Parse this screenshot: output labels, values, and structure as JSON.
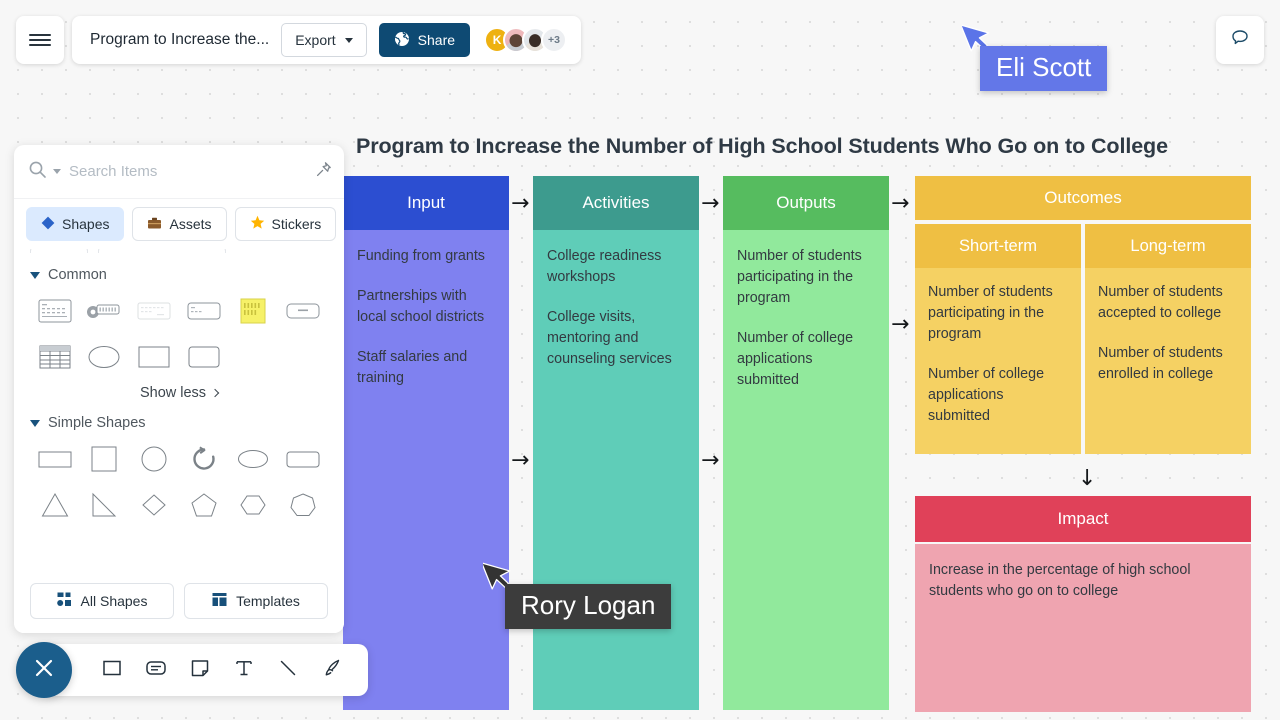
{
  "topbar": {
    "menu_icon": "hamburger-icon",
    "doc_title": "Program to Increase the...",
    "export_label": "Export",
    "share_label": "Share",
    "share_icon": "globe-icon",
    "avatars": [
      {
        "name": "avatar-k",
        "initial": "K",
        "color": "#eeb111"
      },
      {
        "name": "avatar-photo-1",
        "initial": ""
      },
      {
        "name": "avatar-photo-2",
        "initial": ""
      }
    ],
    "avatar_overflow": "+3",
    "comment_icon": "comment-bubble-icon"
  },
  "panel": {
    "search": {
      "placeholder": "Search Items",
      "value": "",
      "icon": "search-icon",
      "caret": "caret-down-icon"
    },
    "pin_icon": "pin-icon",
    "tabs": [
      {
        "label": "Shapes",
        "icon": "diamond-icon",
        "active": true
      },
      {
        "label": "Assets",
        "icon": "briefcase-icon",
        "active": false
      },
      {
        "label": "Stickers",
        "icon": "star-icon",
        "active": false
      }
    ],
    "sections": [
      {
        "title": "Common",
        "items": [
          "card-list-shape",
          "key-shape",
          "faded-list-shape",
          "small-card-shape",
          "sticky-note-shape",
          "rounded-bar-shape",
          "table-shape",
          "ellipse-shape",
          "rectangle-shape",
          "rounded-rect-shape"
        ]
      },
      {
        "title": "Simple Shapes",
        "items": [
          "rectangle-shape",
          "square-shape",
          "circle-shape",
          "arc-arrow-shape",
          "ellipse-shape",
          "rounded-rect-shape",
          "triangle-shape",
          "right-triangle-shape",
          "diamond-shape",
          "pentagon-shape",
          "hexagon-shape",
          "heptagon-shape"
        ]
      }
    ],
    "show_less_label": "Show less",
    "footer": [
      {
        "label": "All Shapes",
        "icon": "grid-shapes-icon"
      },
      {
        "label": "Templates",
        "icon": "template-icon"
      }
    ]
  },
  "toolbar": {
    "close_icon": "close-x-icon",
    "tools": [
      {
        "name": "shape-tool",
        "icon": "square-icon"
      },
      {
        "name": "card-tool",
        "icon": "card-icon"
      },
      {
        "name": "note-tool",
        "icon": "sticky-note-icon"
      },
      {
        "name": "text-tool",
        "icon": "text-t-icon"
      },
      {
        "name": "line-tool",
        "icon": "diagonal-line-icon"
      },
      {
        "name": "pen-tool",
        "icon": "pen-nib-icon"
      }
    ]
  },
  "diagram": {
    "title": "Program to Increase the Number of High School Students Who Go on to College",
    "arrow_right": "→",
    "arrow_down": "↓",
    "columns": [
      {
        "id": "input",
        "header": "Input",
        "header_color": "#2c4ed1",
        "body_color": "#7f81f0",
        "items": [
          "Funding from grants",
          "Partnerships with local school districts",
          "Staff salaries and training"
        ]
      },
      {
        "id": "activities",
        "header": "Activities",
        "header_color": "#3d9b8e",
        "body_color": "#5fcdb8",
        "items": [
          "College readiness workshops",
          "College visits, mentoring and counseling services"
        ]
      },
      {
        "id": "outputs",
        "header": "Outputs",
        "header_color": "#56bc5f",
        "body_color": "#91e99c",
        "items": [
          "Number of students participating in the program",
          "Number of college applications submitted"
        ]
      }
    ],
    "outcomes": {
      "header": "Outcomes",
      "header_color": "#efbf43",
      "sub_head_color": "#efbf43",
      "sub_body_color": "#f5d163",
      "sub_columns": [
        {
          "header": "Short-term",
          "items": [
            "Number of students participating in the program",
            "Number of college applications submitted"
          ]
        },
        {
          "header": "Long-term",
          "items": [
            "Number of students accepted to college",
            "Number of students enrolled in college"
          ]
        }
      ]
    },
    "impact": {
      "header": "Impact",
      "header_color": "#e04159",
      "body_color": "#efa4b0",
      "text": "Increase in the percentage of high school students who go on to college"
    }
  },
  "cursors": [
    {
      "name": "Eli Scott",
      "color": "#6377e8",
      "cursor_color": "#5b74e8"
    },
    {
      "name": "Rory Logan",
      "color": "#3c3c3c",
      "cursor_color": "#333333"
    }
  ]
}
